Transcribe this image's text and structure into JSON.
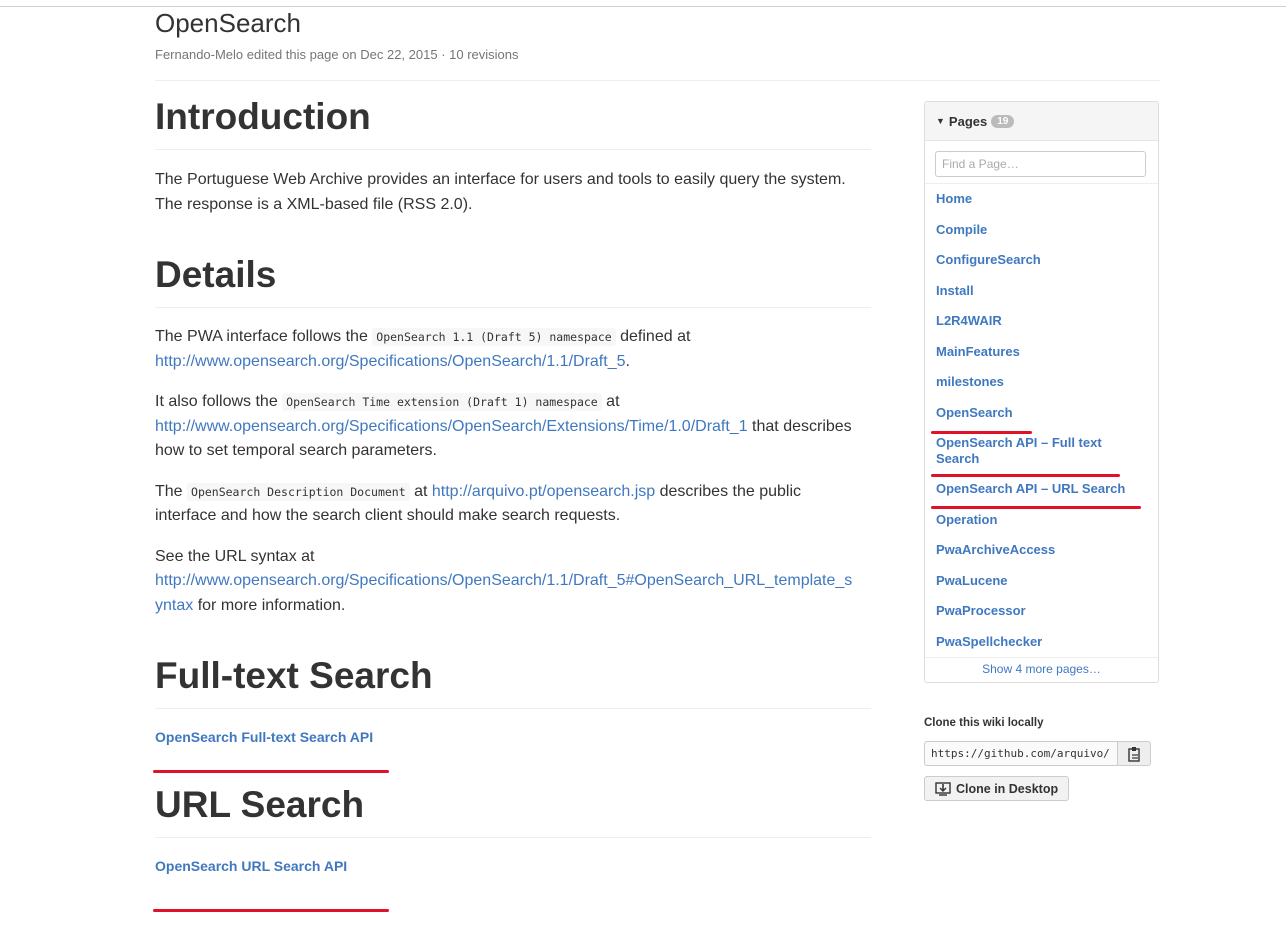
{
  "header": {
    "title": "OpenSearch",
    "meta": "Fernando-Melo edited this page on Dec 22, 2015 · 10 revisions"
  },
  "content": {
    "intro_heading": "Introduction",
    "intro_p1": "The Portuguese Web Archive provides an interface for users and tools to easily query the system.",
    "intro_p2": "The response is a XML-based file (RSS 2.0).",
    "details_heading": "Details",
    "details_p1": {
      "before": "The PWA interface follows the ",
      "code": "OpenSearch 1.1 (Draft 5) namespace",
      "after": " defined at",
      "link": "http://www.opensearch.org/Specifications/OpenSearch/1.1/Draft_5",
      "end": "."
    },
    "details_p2": {
      "before": "It also follows the ",
      "code": "OpenSearch Time extension (Draft 1) namespace",
      "after": " at",
      "link": "http://www.opensearch.org/Specifications/OpenSearch/Extensions/Time/1.0/Draft_1",
      "after_link": " that describes",
      "line3": "how to set temporal search parameters."
    },
    "details_p3": {
      "before": "The ",
      "code": "OpenSearch Description Document",
      "middle": " at ",
      "link": "http://arquivo.pt/opensearch.jsp",
      "after": " describes the public",
      "line2": "interface and how the search client should make search requests."
    },
    "details_p4": {
      "line1": "See the URL syntax at",
      "link_part1": "http://www.opensearch.org/Specifications/OpenSearch/1.1/Draft_5#OpenSearch_URL_template_s",
      "link_part2": "yntax",
      "after": " for more information."
    },
    "fulltext_heading": "Full-text Search",
    "fulltext_link": "OpenSearch Full-text Search API",
    "url_heading": "URL Search",
    "url_link": "OpenSearch URL Search API"
  },
  "sidebar": {
    "pages_label": "Pages",
    "pages_count": "19",
    "find_placeholder": "Find a Page…",
    "pages": [
      "Home",
      "Compile",
      "ConfigureSearch",
      "Install",
      "L2R4WAIR",
      "MainFeatures",
      "milestones",
      "OpenSearch",
      "OpenSearch API – Full text Search",
      "OpenSearch API – URL Search",
      "Operation",
      "PwaArchiveAccess",
      "PwaLucene",
      "PwaProcessor",
      "PwaSpellchecker"
    ],
    "show_more": "Show 4 more pages…",
    "clone_title": "Clone this wiki locally",
    "clone_url": "https://github.com/arquivo/",
    "clone_desktop": "Clone in Desktop"
  },
  "colors": {
    "link": "#4078c0",
    "annotation_red": "#e0122a"
  },
  "icons": [
    "caret-down-icon",
    "clipboard-icon",
    "desktop-download-icon"
  ]
}
